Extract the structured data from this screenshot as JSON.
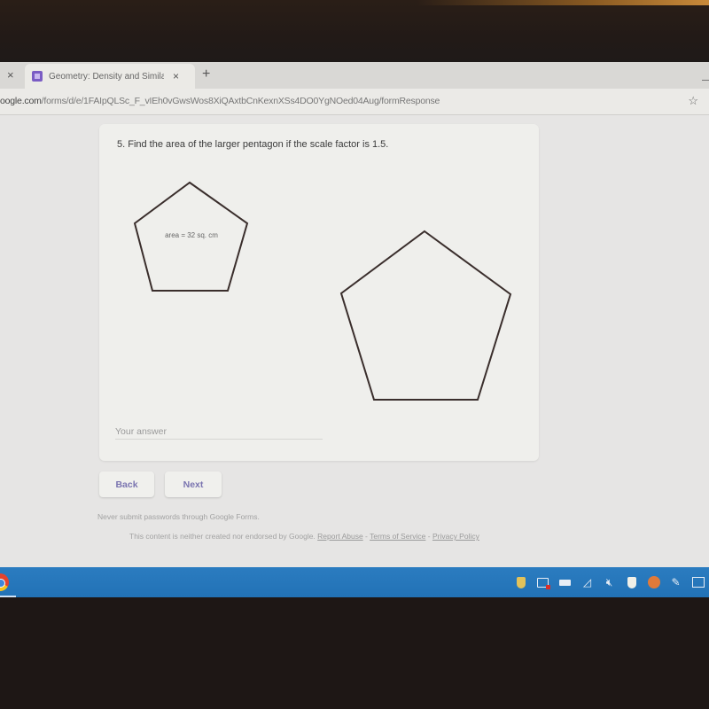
{
  "browser": {
    "tab_title": "Geometry: Density and Similarity",
    "tab_close": "×",
    "prev_tab_close": "×",
    "new_tab": "+",
    "url_domain": "oogle.com",
    "url_path": "/forms/d/e/1FAIpQLSc_F_vIEh0vGwsWos8XiQAxtbCnKexnXSs4DO0YgNOed04Aug/formResponse",
    "star_icon": "☆"
  },
  "form": {
    "question": "5. Find the area of the larger pentagon if the scale factor is 1.5.",
    "small_pentagon_label": "area = 32 sq. cm",
    "answer_placeholder": "Your answer",
    "answer_value": "",
    "back_label": "Back",
    "next_label": "Next",
    "colors": {
      "button_text": "#7a74b0",
      "shape_stroke": "#3a2e2c"
    }
  },
  "footer": {
    "warning": "Never submit passwords through Google Forms.",
    "legal_text": "This content is neither created nor endorsed by Google.",
    "report_abuse": "Report Abuse",
    "terms": "Terms of Service",
    "privacy": "Privacy Policy",
    "separator": " - "
  },
  "taskbar": {
    "color": "#2474b8",
    "tray_icons": [
      "security-shield-icon",
      "remote-display-icon",
      "battery-icon",
      "wifi-icon",
      "volume-muted-icon",
      "defender-icon",
      "antivirus-icon",
      "pen-icon",
      "notifications-icon"
    ],
    "wifi_glyph": "◿",
    "volume_glyph": "🔇︎",
    "pen_glyph": "✎"
  }
}
